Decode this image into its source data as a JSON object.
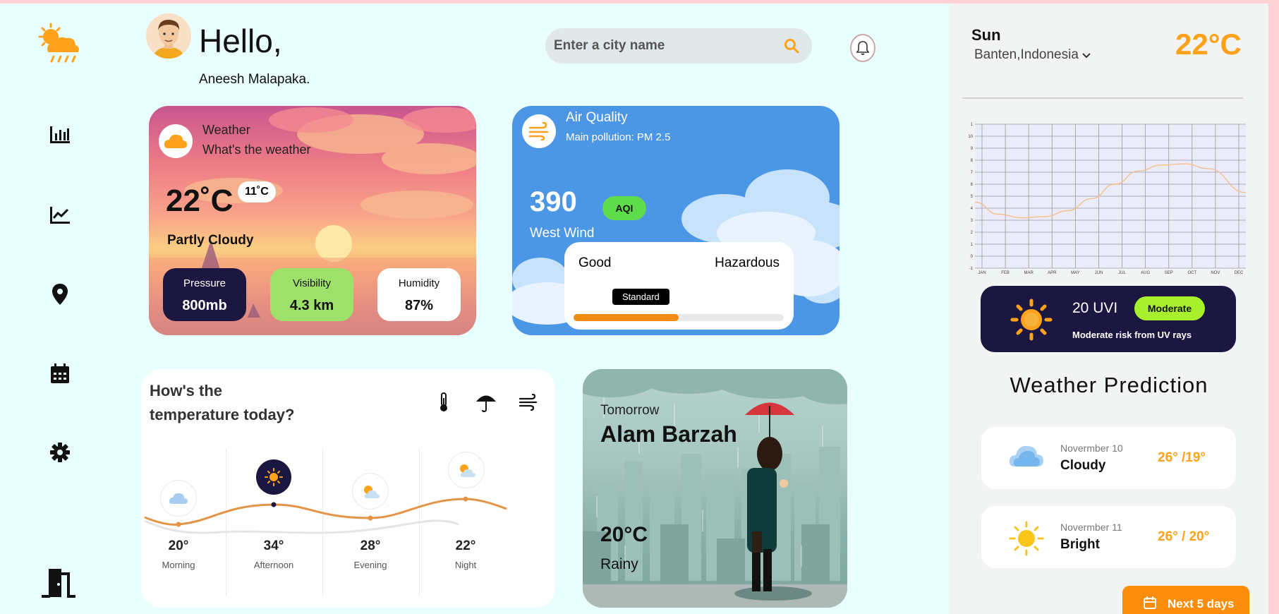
{
  "header": {
    "greeting": "Hello,",
    "user_name": "Aneesh Malapaka.",
    "search_placeholder": "Enter a city name"
  },
  "weather_card": {
    "label": "Weather",
    "subtitle": "What's the weather",
    "temperature": "22˚C",
    "low_temperature": "11˚C",
    "condition": "Partly Cloudy",
    "stats": [
      {
        "label": "Pressure",
        "value": "800mb",
        "bg": "#1c1741",
        "fg": "#ffffff"
      },
      {
        "label": "Visibility",
        "value": "4.3 km",
        "bg": "#9de06a",
        "fg": "#111111"
      },
      {
        "label": "Humidity",
        "value": "87%",
        "bg": "#ffffff",
        "fg": "#111111"
      }
    ]
  },
  "air_quality": {
    "title": "Air Quality",
    "pollution": "Main pollution: PM 2.5",
    "value": "390",
    "wind": "West Wind",
    "badge": "AQI",
    "scale_low": "Good",
    "scale_high": "Hazardous",
    "scale_marker": "Standard",
    "scale_fill_fraction": 0.5
  },
  "temperature_today": {
    "title_line1": "How's the",
    "title_line2": "temperature today?",
    "filter_icons": [
      "thermometer-icon",
      "umbrella-icon",
      "wind-icon"
    ],
    "periods": [
      {
        "value": "20°",
        "name": "Morning",
        "icon": "cloud-icon"
      },
      {
        "value": "34°",
        "name": "Afternoon",
        "icon": "sun-icon"
      },
      {
        "value": "28°",
        "name": "Evening",
        "icon": "sun-cloud-icon"
      },
      {
        "value": "22°",
        "name": "Night",
        "icon": "sun-cloud-icon"
      }
    ]
  },
  "tomorrow": {
    "label": "Tomorrow",
    "city": "Alam Barzah",
    "temperature": "20°C",
    "condition": "Rainy"
  },
  "right_panel": {
    "day": "Sun",
    "location": "Banten,Indonesia",
    "temperature": "22°C",
    "uv": {
      "value": "20 UVI",
      "level": "Moderate",
      "description": "Moderate risk from UV rays"
    },
    "prediction_title": "Weather Prediction",
    "predictions": [
      {
        "date": "Novermber 10",
        "condition": "Cloudy",
        "range": "26° /19°",
        "icon": "cloud-icon"
      },
      {
        "date": "Novermber 11",
        "condition": "Bright",
        "range": "26° / 20°",
        "icon": "sun-icon"
      }
    ],
    "next_button": "Next 5 days"
  },
  "chart_data": {
    "type": "line",
    "categories": [
      "JAN",
      "FEB",
      "MAR",
      "APR",
      "MAY",
      "JUN",
      "JUL",
      "AUG",
      "SEP",
      "OCT",
      "NOV",
      "DEC"
    ],
    "values": [
      4.5,
      3.5,
      3.2,
      3.3,
      3.8,
      4.8,
      6.0,
      7.1,
      7.6,
      7.7,
      7.3,
      5.3
    ],
    "y_ticks": [
      "-1",
      "0",
      "1",
      "2",
      "3",
      "4",
      "5",
      "6",
      "7",
      "8",
      "9",
      "10",
      "1"
    ],
    "ylim": [
      -1,
      11
    ],
    "grid": true,
    "line_color": "#f4c08a"
  },
  "colors": {
    "accent": "#fda21a",
    "dark": "#1c1741",
    "aqi_green": "#5fdc4c",
    "uv_green": "#a8f02b"
  }
}
